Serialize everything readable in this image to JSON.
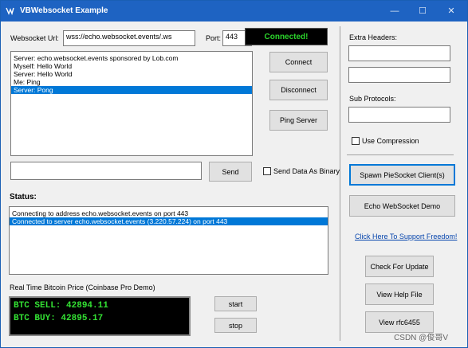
{
  "window": {
    "title": "VBWebsocket Example",
    "minimize_icon": "minimize-icon",
    "maximize_icon": "maximize-icon",
    "close_icon": "close-icon"
  },
  "connection": {
    "url_label": "Websocket Url:",
    "url_value": "wss://echo.websocket.events/.ws",
    "port_label": "Port:",
    "port_value": "443",
    "status_text": "Connected!"
  },
  "messages": {
    "items": [
      "Server: echo.websocket.events sponsored by Lob.com",
      "Myself: Hello World",
      "Server: Hello World",
      "Me: Ping",
      "Server: Pong"
    ],
    "selected_index": 4
  },
  "actions": {
    "connect": "Connect",
    "disconnect": "Disconnect",
    "ping": "Ping Server"
  },
  "send": {
    "input_value": "",
    "send_label": "Send",
    "binary_label": "Send Data As Binary",
    "binary_checked": false
  },
  "status": {
    "heading": "Status:",
    "items": [
      "Connecting to address echo.websocket.events on port 443",
      "Connected to server echo.websocket.events (3.220.57.224) on port 443"
    ],
    "selected_index": 1
  },
  "bitcoin": {
    "heading": "Real Time Bitcoin Price  (Coinbase Pro Demo)",
    "sell": "BTC SELL: 42894.11",
    "buy": "BTC BUY: 42895.17",
    "start": "start",
    "stop": "stop"
  },
  "right_panel": {
    "extra_headers_label": "Extra Headers:",
    "header1_value": "",
    "header2_value": "",
    "sub_protocols_label": "Sub Protocols:",
    "sub_protocols_value": "",
    "compression_label": "Use Compression",
    "compression_checked": false,
    "spawn_label": "Spawn PieSocket Client(s)",
    "echo_demo_label": "Echo WebSocket Demo",
    "support_link": "Click Here To Support Freedom!",
    "check_update": "Check For Update",
    "view_help": "View Help File",
    "view_rfc": "View rfc6455"
  },
  "watermark": "CSDN @俊哥V",
  "colors": {
    "titlebar": "#1e63c2",
    "selection": "#0078d7",
    "status_green": "#2bd42b",
    "btc_green": "#33e033",
    "link": "#0645ad"
  }
}
